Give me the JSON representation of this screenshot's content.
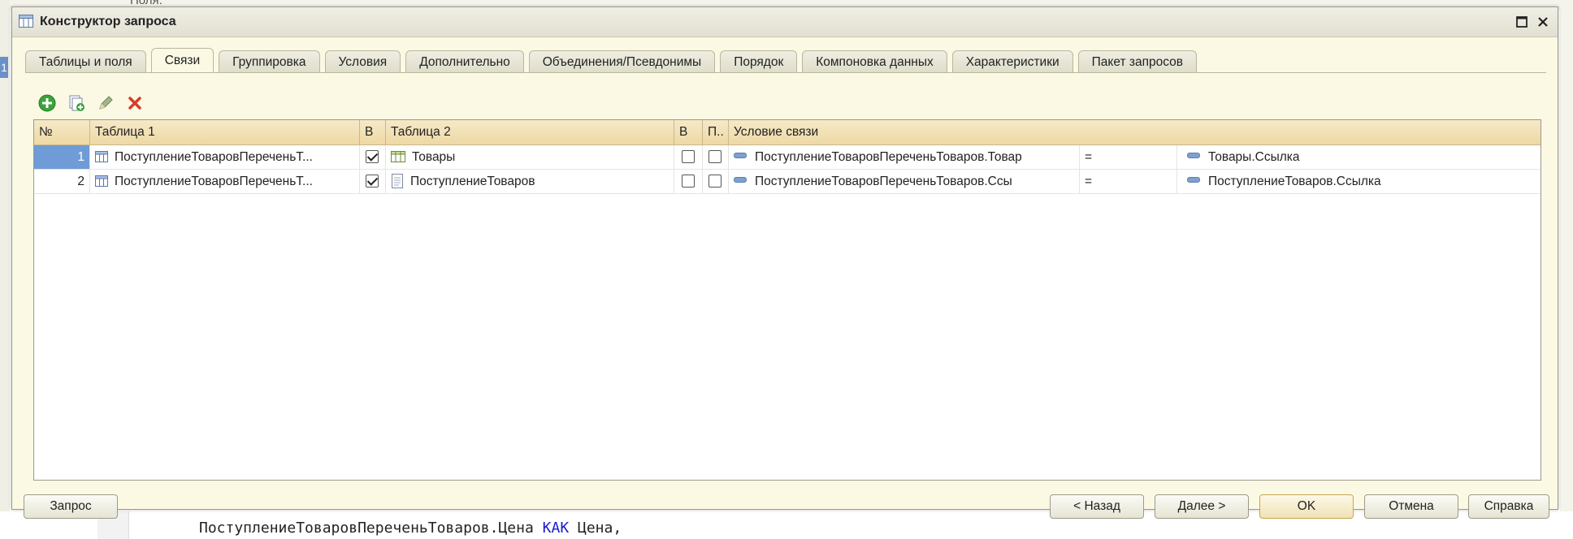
{
  "background": {
    "top_text": "Поля:",
    "left_marker": "1",
    "code_line": {
      "part1": "ПоступлениеТоваровПереченьТоваров.Цена ",
      "keyword": "КАК",
      "part2": " Цена,"
    }
  },
  "dialog": {
    "title": "Конструктор запроса",
    "tabs": [
      {
        "label": "Таблицы и поля"
      },
      {
        "label": "Связи"
      },
      {
        "label": "Группировка"
      },
      {
        "label": "Условия"
      },
      {
        "label": "Дополнительно"
      },
      {
        "label": "Объединения/Псевдонимы"
      },
      {
        "label": "Порядок"
      },
      {
        "label": "Компоновка данных"
      },
      {
        "label": "Характеристики"
      },
      {
        "label": "Пакет запросов"
      }
    ],
    "active_tab": 1
  },
  "grid": {
    "headers": {
      "num": "№",
      "table1": "Таблица 1",
      "all1": "В",
      "table2": "Таблица 2",
      "all2": "В",
      "required": "П..",
      "condition": "Условие связи"
    },
    "rows": [
      {
        "num": "1",
        "table1": "ПоступлениеТоваровПереченьТ...",
        "all1": true,
        "table2": "Товары",
        "table2_icon": "catalog-table-icon",
        "all2": false,
        "required": false,
        "left_field": "ПоступлениеТоваровПереченьТоваров.Товар",
        "operator": "=",
        "right_field": "Товары.Ссылка"
      },
      {
        "num": "2",
        "table1": "ПоступлениеТоваровПереченьТ...",
        "all1": true,
        "table2": "ПоступлениеТоваров",
        "table2_icon": "document-icon",
        "all2": false,
        "required": false,
        "left_field": "ПоступлениеТоваровПереченьТоваров.Ссы",
        "operator": "=",
        "right_field": "ПоступлениеТоваров.Ссылка"
      }
    ]
  },
  "buttons": {
    "query": "Запрос",
    "back": "< Назад",
    "next": "Далее >",
    "ok": "OK",
    "cancel": "Отмена",
    "help": "Справка"
  },
  "colors": {
    "dialog_bg": "#fbf9e4",
    "header_bg": "#eed9a4",
    "selection": "#6f9bd6",
    "delete_red": "#d93a2b",
    "add_green": "#3aa33a"
  }
}
